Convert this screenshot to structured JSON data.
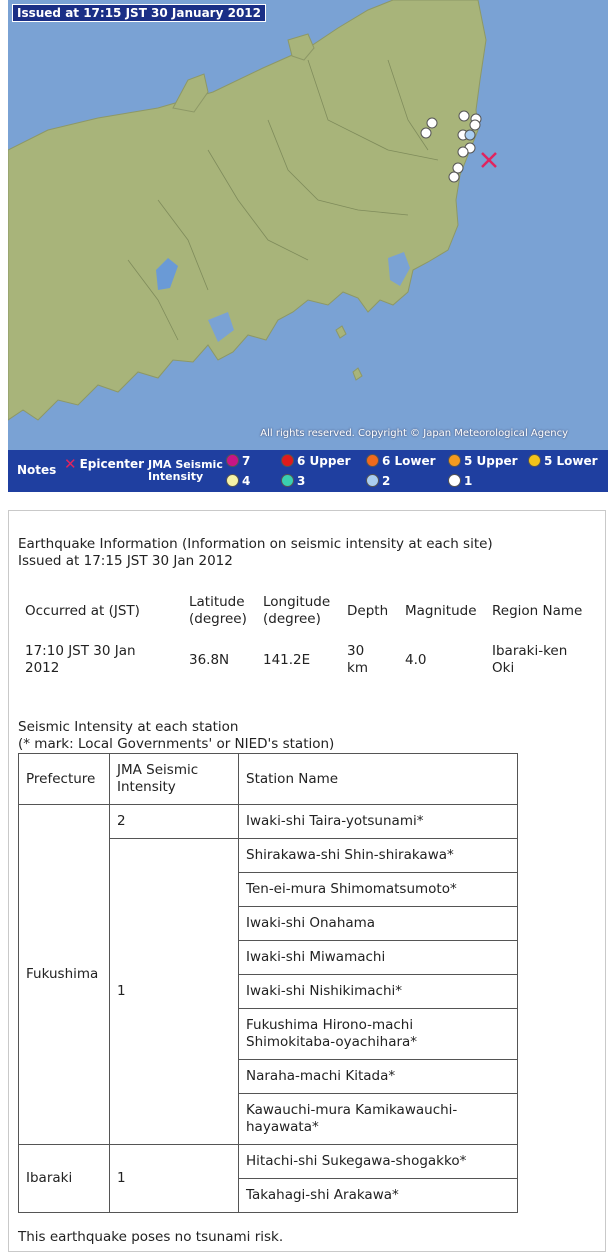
{
  "map": {
    "issued": "Issued at 17:15 JST  30 January 2012",
    "copyright": "All rights reserved. Copyright © Japan Meteorological Agency",
    "colors": {
      "sea": "#7aa2d4",
      "land": "#a8b47a",
      "lake": "#6a9ad6",
      "epicenter": "#e0245e"
    }
  },
  "legend": {
    "notes": "Notes",
    "epicenter": "Epicenter",
    "jma_title": "JMA Seismic\nIntensity",
    "levels": [
      {
        "label": "7",
        "color": "#c71585"
      },
      {
        "label": "6 Upper",
        "color": "#e01b1b"
      },
      {
        "label": "6 Lower",
        "color": "#f06a1c"
      },
      {
        "label": "5 Upper",
        "color": "#f49a1f"
      },
      {
        "label": "5 Lower",
        "color": "#f3c41a"
      },
      {
        "label": "4",
        "color": "#f6f2a6"
      },
      {
        "label": "3",
        "color": "#3ad0b0"
      },
      {
        "label": "2",
        "color": "#a9cdf0"
      },
      {
        "label": "1",
        "color": "#ffffff"
      }
    ]
  },
  "info": {
    "title": "Earthquake Information (Information on seismic intensity at each site)",
    "issued": "Issued at 17:15 JST 30 Jan 2012",
    "headers": {
      "occurred": "Occurred at (JST)",
      "latitude": "Latitude\n(degree)",
      "longitude": "Longitude\n(degree)",
      "depth": "Depth",
      "magnitude": "Magnitude",
      "region": "Region Name"
    },
    "values": {
      "occurred": "17:10 JST 30 Jan\n2012",
      "latitude": "36.8N",
      "longitude": "141.2E",
      "depth": "30\nkm",
      "magnitude": "4.0",
      "region": "Ibaraki-ken\nOki"
    },
    "station_title": "Seismic Intensity at each station",
    "station_note": "(* mark: Local Governments' or NIED's station)",
    "table_headers": {
      "prefecture": "Prefecture",
      "intensity": "JMA Seismic\nIntensity",
      "station": "Station Name"
    },
    "fukushima": {
      "name": "Fukushima",
      "i2": "2",
      "i1": "1",
      "stations2": [
        "Iwaki-shi Taira-yotsunami*"
      ],
      "stations1": [
        "Shirakawa-shi Shin-shirakawa*",
        "Ten-ei-mura Shimomatsumoto*",
        "Iwaki-shi Onahama",
        "Iwaki-shi Miwamachi",
        "Iwaki-shi Nishikimachi*",
        "Fukushima Hirono-machi\nShimokitaba-oyachihara*",
        "Naraha-machi Kitada*",
        "Kawauchi-mura Kamikawauchi-\nhayawata*"
      ]
    },
    "ibaraki": {
      "name": "Ibaraki",
      "i1": "1",
      "stations1": [
        "Hitachi-shi Sukegawa-shogakko*",
        "Takahagi-shi Arakawa*"
      ]
    },
    "tsunami": "This earthquake poses no tsunami risk."
  }
}
